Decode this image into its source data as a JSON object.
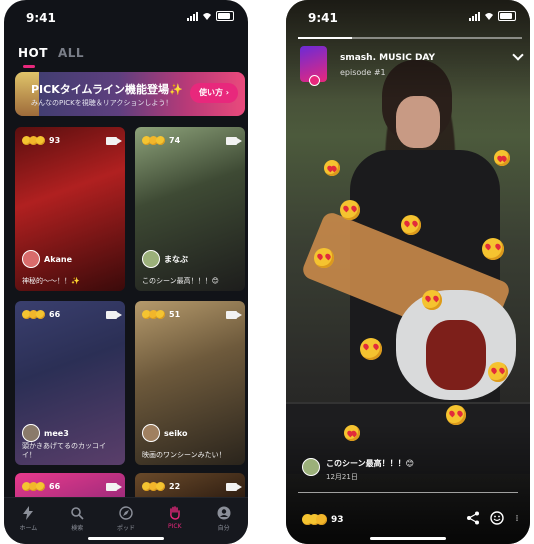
{
  "status": {
    "time": "9:41"
  },
  "left": {
    "tabs": [
      {
        "label": "HOT",
        "active": true
      },
      {
        "label": "ALL",
        "active": false
      }
    ],
    "banner": {
      "title": "PICKタイムライン機能登場✨",
      "subtitle": "みんなのPICKを視聴＆リアクションしよう！",
      "button": "使い方 ›"
    },
    "cards": [
      {
        "count": "93",
        "user": "Akane",
        "caption": "神秘的〜〜！！✨"
      },
      {
        "count": "74",
        "user": "まなぶ",
        "caption": "このシーン最高！！！😊"
      },
      {
        "count": "66",
        "user": "mee3",
        "caption": "頭かきあげてるのカッコイイ！"
      },
      {
        "count": "51",
        "user": "seiko",
        "caption": "映画のワンシーンみたい！"
      },
      {
        "count": "66"
      },
      {
        "count": "22"
      }
    ],
    "tabbar": [
      {
        "label": "ホーム",
        "icon": "lightning-icon",
        "active": false
      },
      {
        "label": "検索",
        "icon": "search-icon",
        "active": false
      },
      {
        "label": "ポッド",
        "icon": "compass-icon",
        "active": false
      },
      {
        "label": "PICK",
        "icon": "hand-icon",
        "active": true
      },
      {
        "label": "自分",
        "icon": "profile-icon",
        "active": false
      }
    ],
    "accent": "#e8287c"
  },
  "right": {
    "show_title": "smash. MUSIC DAY",
    "episode": "episode #1",
    "progress": 0.24,
    "comment": {
      "text": "このシーン最高！！！😊",
      "date": "12月21日"
    },
    "reaction_count": "93"
  }
}
